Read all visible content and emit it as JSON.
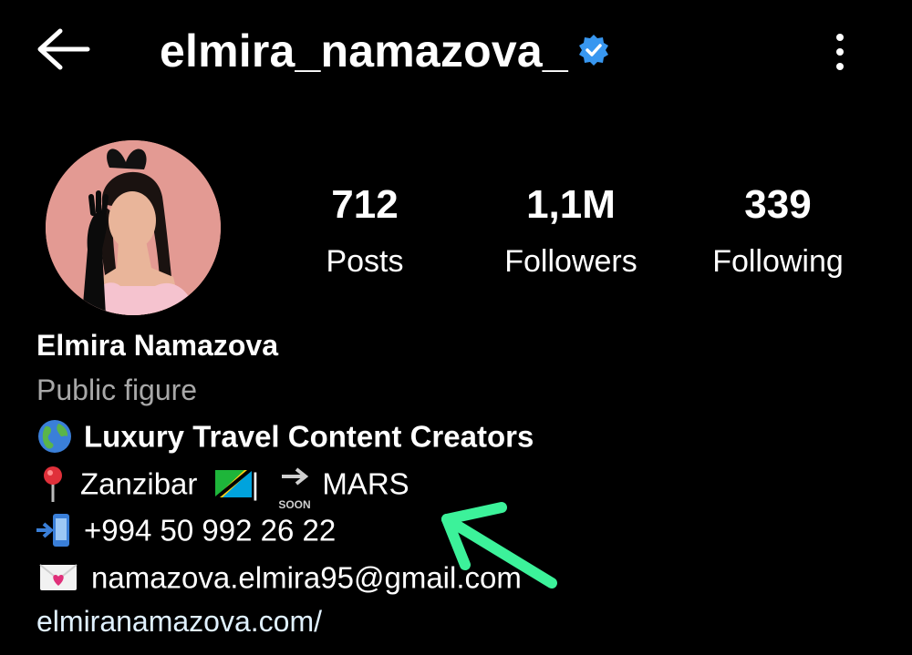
{
  "header": {
    "username": "elmira_namazova_",
    "back_icon": "arrow-left-icon",
    "verified_icon": "verified-badge-icon",
    "more_icon": "more-vertical-icon"
  },
  "stats": {
    "posts": {
      "value": "712",
      "label": "Posts"
    },
    "followers": {
      "value": "1,1M",
      "label": "Followers"
    },
    "following": {
      "value": "339",
      "label": "Following"
    }
  },
  "profile": {
    "full_name": "Elmira Namazova",
    "category": "Public figure",
    "bio": {
      "line1": "Luxury Travel Content Creators",
      "line2_location": "Zanzibar",
      "line2_separator": "|",
      "line2_soon": "SOON",
      "line2_destination": "MARS",
      "line3": "+994 50 992 26 22",
      "line4": "namazova.elmira95@gmail.com"
    },
    "website": "elmiranamazova.com/"
  },
  "colors": {
    "background": "#000000",
    "verified_blue": "#3897f0",
    "secondary_text": "#a8a8a8",
    "link": "#e0f1ff",
    "annotation_arrow": "#3cf29a"
  }
}
